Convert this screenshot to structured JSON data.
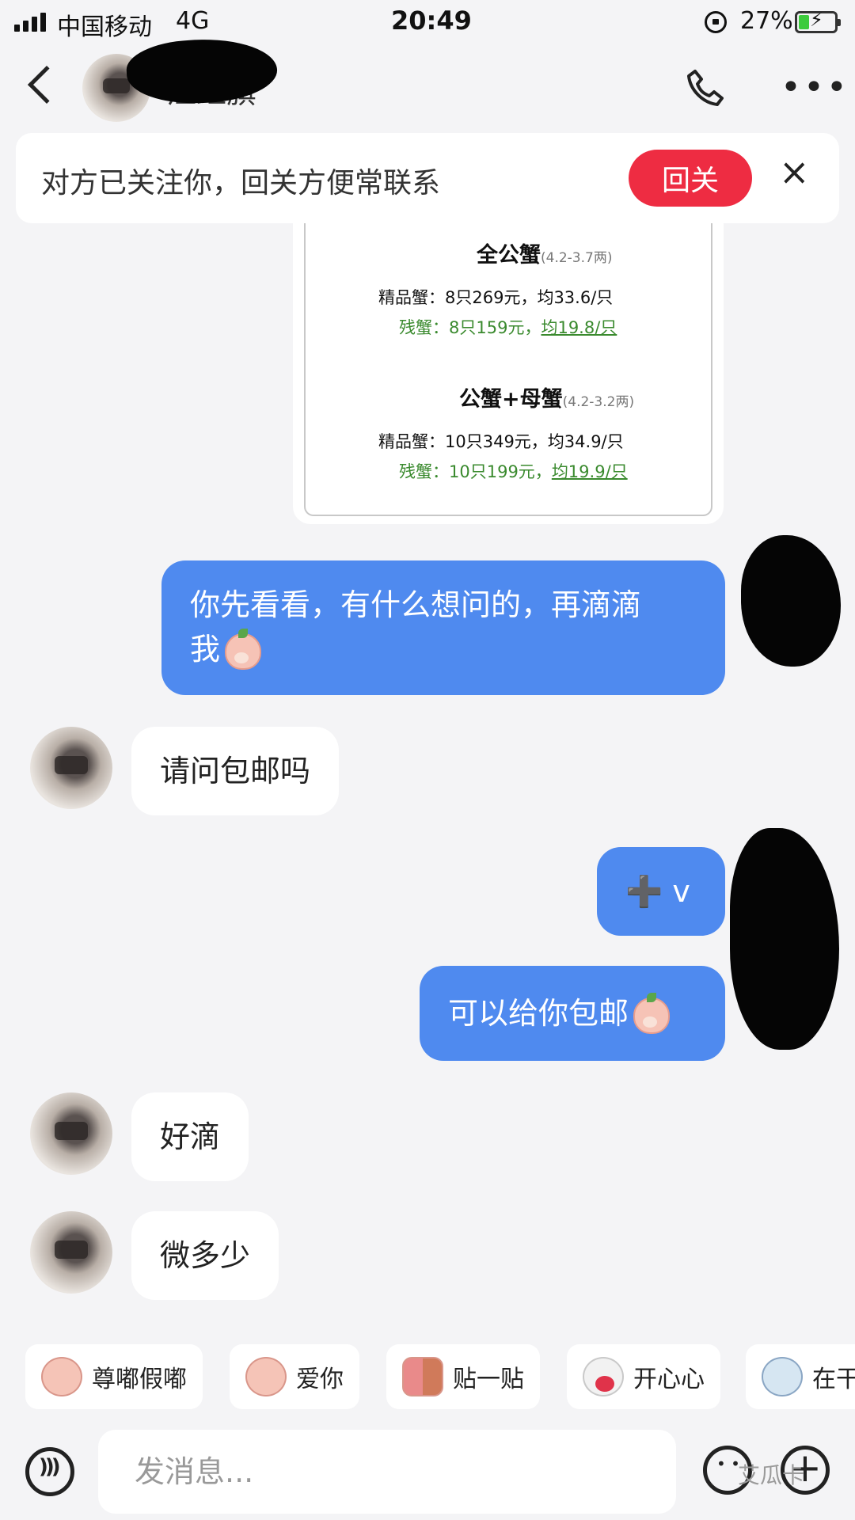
{
  "status_bar": {
    "carrier": "中国移动",
    "network": "4G",
    "time": "20:49",
    "battery": "27%"
  },
  "header": {
    "contact_name": "江红旗",
    "icons": [
      "back-icon",
      "phone-icon",
      "more-icon"
    ]
  },
  "banner": {
    "text": "对方已关注你，回关方便常联系",
    "follow_label": "回关",
    "close_label": "×"
  },
  "price_card": {
    "groups": [
      {
        "title": "全公蟹",
        "weight": "(4.2-3.7两)",
        "premium": "精品蟹：8只269元，均33.6/只",
        "defect_prefix": "残蟹：8只159元，",
        "defect_avg": "均19.8/只"
      },
      {
        "title": "公蟹+母蟹",
        "weight": "(4.2-3.2两)",
        "premium": "精品蟹：10只349元，均34.9/只",
        "defect_prefix": "残蟹：10只199元，",
        "defect_avg": "均19.9/只"
      }
    ]
  },
  "messages": [
    {
      "direction": "out",
      "line1": "你先看看，有什么想问的，再滴滴",
      "line2": "我"
    },
    {
      "direction": "in",
      "text": "请问包邮吗"
    },
    {
      "direction": "out",
      "text": "➕ v"
    },
    {
      "direction": "out",
      "text": "可以给你包邮"
    },
    {
      "direction": "in",
      "text": "好滴"
    },
    {
      "direction": "in",
      "text": "微多少"
    }
  ],
  "stickers": [
    {
      "label": "尊嘟假嘟",
      "icon": "peach-face-icon"
    },
    {
      "label": "爱你",
      "icon": "peach-love-icon"
    },
    {
      "label": "贴一贴",
      "icon": "hug-sticker-icon"
    },
    {
      "label": "开心心",
      "icon": "heart-sticker-icon"
    },
    {
      "label": "在干",
      "icon": "blue-sticker-icon"
    }
  ],
  "input": {
    "placeholder": "发消息...",
    "watermark": "艾瓜卡"
  }
}
